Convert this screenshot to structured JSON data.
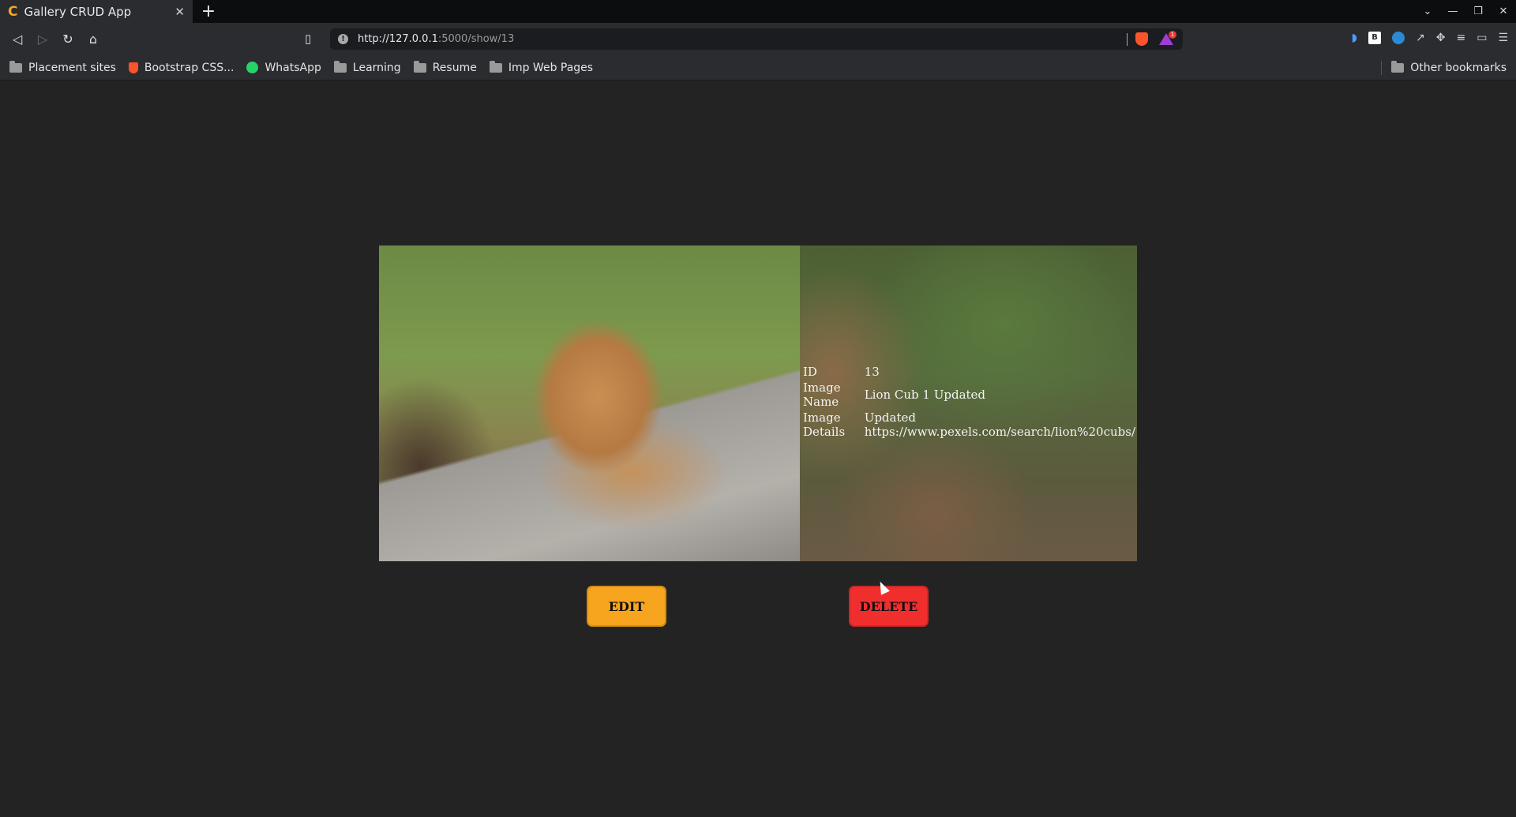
{
  "browser": {
    "tab_title": "Gallery CRUD App",
    "tab_favicon": "C",
    "url_host": "http://127.0.0.1",
    "url_path": ":5000/show/13",
    "rewards_badge": "1",
    "bookmarks": [
      {
        "label": "Placement sites",
        "icon": "folder-icon"
      },
      {
        "label": "Bootstrap CSS...",
        "icon": "brave-shield-icon"
      },
      {
        "label": "WhatsApp",
        "icon": "whatsapp-icon"
      },
      {
        "label": "Learning",
        "icon": "folder-icon"
      },
      {
        "label": "Resume",
        "icon": "folder-icon"
      },
      {
        "label": "Imp Web Pages",
        "icon": "folder-icon"
      }
    ],
    "other_bookmarks": "Other bookmarks"
  },
  "details": {
    "id_label": "ID",
    "id_value": "13",
    "name_label": "Image Name",
    "name_value": "Lion Cub 1 Updated",
    "details_label": "Image Details",
    "details_value": "Updated https://www.pexels.com/search/lion%20cubs/"
  },
  "actions": {
    "edit_label": "EDIT",
    "delete_label": "DELETE"
  },
  "colors": {
    "page_bg": "#232323",
    "edit_bg": "#f7a51e",
    "delete_bg": "#f12e2e"
  }
}
